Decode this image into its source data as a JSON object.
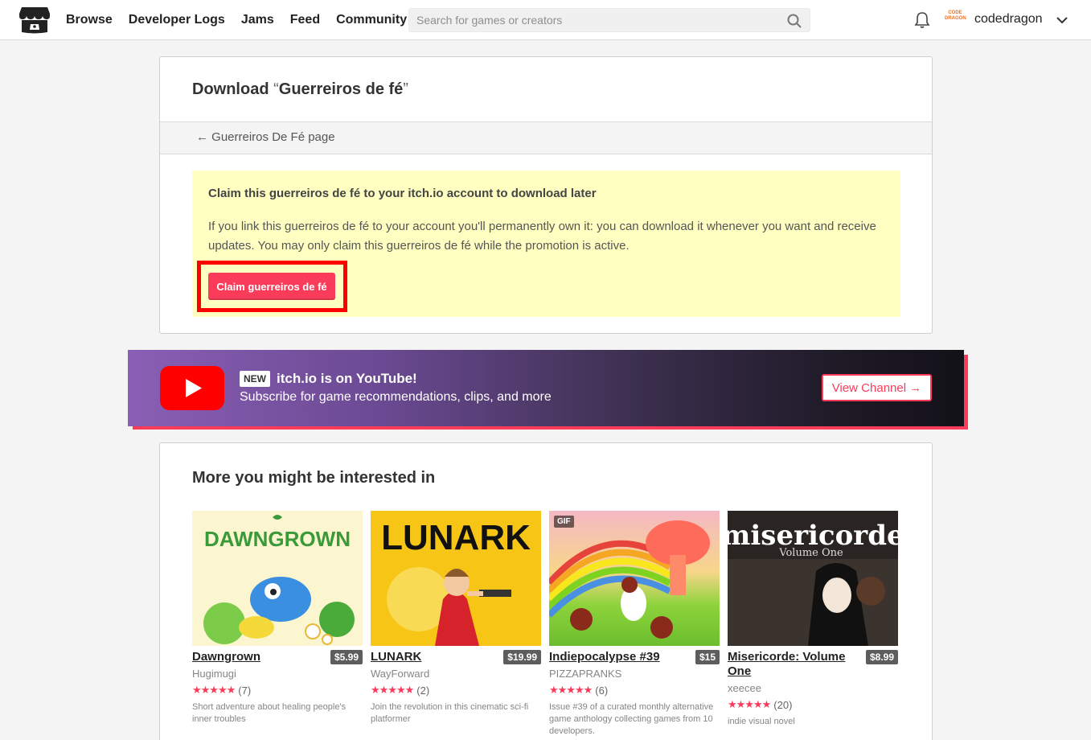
{
  "header": {
    "nav": [
      "Browse",
      "Developer Logs",
      "Jams",
      "Feed",
      "Community"
    ],
    "search_placeholder": "Search for games or creators",
    "avatar_text": "CODE DRAGON",
    "username": "codedragon"
  },
  "download": {
    "title_prefix": "Download ",
    "quote_open": "“",
    "game_name": "Guerreiros de fé",
    "quote_close": "”",
    "back_link": "← Guerreiros De Fé page",
    "claim_heading": "Claim this guerreiros de fé to your itch.io account to download later",
    "claim_text": "If you link this guerreiros de fé to your account you'll permanently own it: you can download it whenever you want and receive updates. You may only claim this guerreiros de fé while the promotion is active.",
    "claim_button": "Claim guerreiros de fé"
  },
  "youtube": {
    "badge": "NEW",
    "title": "itch.io is on YouTube!",
    "subtitle": "Subscribe for game recommendations, clips, and more",
    "button": "View Channel →"
  },
  "recommendations": {
    "title": "More you might be interested in",
    "games": [
      {
        "title": "Dawngrown",
        "price": "$5.99",
        "author": "Hugimugi",
        "stars": "★★★★★",
        "count": "(7)",
        "desc": "Short adventure about healing people's inner troubles",
        "thumb_text": "DAWNGROWN",
        "colors": [
          "#f9f4c8",
          "#3a9a3a"
        ]
      },
      {
        "title": "LUNARK",
        "price": "$19.99",
        "author": "WayForward",
        "stars": "★★★★★",
        "count": "(2)",
        "desc": "Join the revolution in this cinematic sci-fi platformer",
        "thumb_text": "LUNARK",
        "colors": [
          "#f5c218",
          "#111111"
        ]
      },
      {
        "title": "Indiepocalypse #39",
        "price": "$15",
        "author": "PIZZAPRANKS",
        "stars": "★★★★★",
        "count": "(6)",
        "desc": "Issue #39 of a curated monthly alternative game anthology collecting games from 10 developers.",
        "thumb_text": "GIF",
        "colors": [
          "#8dd33b",
          "#e6433a"
        ]
      },
      {
        "title": "Misericorde: Volume One",
        "price": "$8.99",
        "author": "xeecee",
        "stars": "★★★★★",
        "count": "(20)",
        "desc": "indie visual novel",
        "thumb_text": "misericorde",
        "thumb_sub": "Volume One",
        "colors": [
          "#2a2522",
          "#ffffff"
        ]
      }
    ]
  }
}
